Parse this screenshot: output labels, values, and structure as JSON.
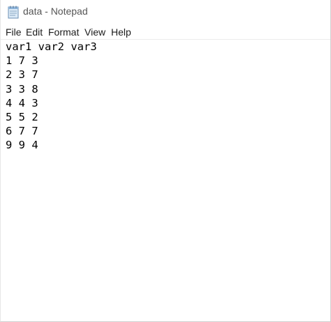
{
  "window": {
    "title": "data - Notepad",
    "app_icon": "notepad-icon"
  },
  "menu": {
    "items": [
      {
        "label": "File"
      },
      {
        "label": "Edit"
      },
      {
        "label": "Format"
      },
      {
        "label": "View"
      },
      {
        "label": "Help"
      }
    ]
  },
  "document": {
    "content": "var1 var2 var3\n1 7 3\n2 3 7\n3 3 8\n4 4 3\n5 5 2\n6 7 7\n9 9 4"
  }
}
